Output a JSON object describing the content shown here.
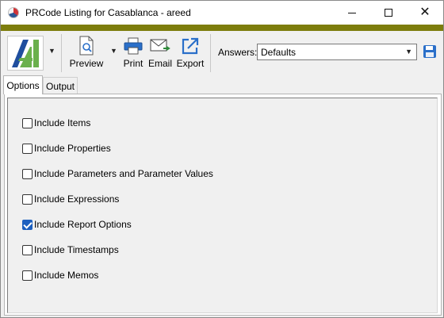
{
  "window": {
    "title": "PRCode Listing for Casablanca - areed"
  },
  "toolbar": {
    "preview_label": "Preview",
    "print_label": "Print",
    "email_label": "Email",
    "export_label": "Export",
    "answers_label": "Answers:",
    "answers_value": "Defaults"
  },
  "tabs": {
    "options": "Options",
    "output": "Output"
  },
  "options": [
    {
      "label": "Include Items",
      "checked": false
    },
    {
      "label": "Include Properties",
      "checked": false
    },
    {
      "label": "Include Parameters and Parameter Values",
      "checked": false
    },
    {
      "label": "Include Expressions",
      "checked": false
    },
    {
      "label": "Include Report Options",
      "checked": true
    },
    {
      "label": "Include Timestamps",
      "checked": false
    },
    {
      "label": "Include Memos",
      "checked": false
    }
  ],
  "colors": {
    "accent_band": "#7d7d0c",
    "checkbox_checked": "#1c5fbf",
    "logo_green": "#6ab04c",
    "logo_blue": "#1f4e9e"
  },
  "icons": {
    "app": "app-pie-icon",
    "minimize": "minimize-icon",
    "maximize": "maximize-icon",
    "close": "close-icon",
    "preview": "document-magnify-icon",
    "print": "printer-icon",
    "email": "envelope-icon",
    "export": "export-arrow-icon",
    "save": "floppy-disk-icon"
  }
}
